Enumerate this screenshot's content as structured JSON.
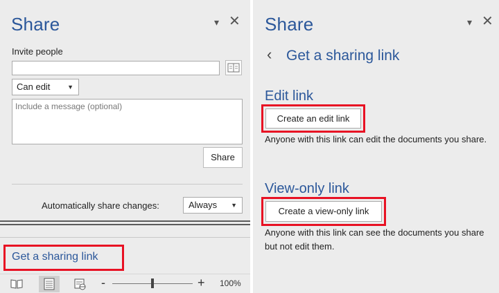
{
  "left_pane": {
    "title": "Share",
    "invite_label": "Invite people",
    "invite_value": "",
    "permission_value": "Can edit",
    "message_placeholder": "Include a message (optional)",
    "share_button": "Share",
    "auto_share_label": "Automatically share changes:",
    "auto_share_value": "Always",
    "get_link_label": "Get a sharing link"
  },
  "status_bar": {
    "icons": [
      "read-mode-icon",
      "print-layout-icon",
      "web-layout-icon"
    ],
    "zoom_minus": "-",
    "zoom_plus": "+",
    "zoom_level": "100%",
    "zoom_fraction": 0.5
  },
  "right_pane": {
    "title": "Share",
    "subtitle": "Get a sharing link",
    "edit_heading": "Edit link",
    "edit_button": "Create an edit link",
    "edit_desc": "Anyone with this link can edit the documents you share.",
    "view_heading": "View-only link",
    "view_button": "Create a view-only link",
    "view_desc": "Anyone with this link can see the documents you share but not edit them."
  },
  "colors": {
    "accent": "#2b579a",
    "highlight": "#e81123",
    "pane_bg": "#ececec"
  }
}
